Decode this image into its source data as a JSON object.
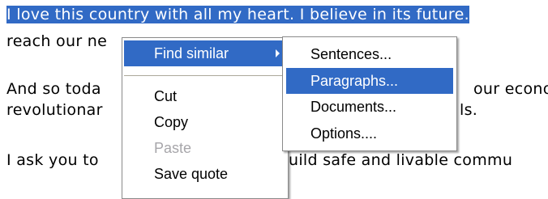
{
  "document": {
    "line1": "I love this country with all my heart. I believe in its future.",
    "line2": "reach our ne",
    "line3_start": "And so toda",
    "line3_end": "our econo",
    "line4_start": "revolutionar",
    "line4_end": "ls.",
    "line5_start": "I ask you to",
    "line5_end": "uild safe and livable commu"
  },
  "context_menu": {
    "find_similar": "Find similar",
    "cut": "Cut",
    "copy": "Copy",
    "paste": "Paste",
    "save_quote": "Save quote"
  },
  "submenu": {
    "sentences": "Sentences...",
    "paragraphs": "Paragraphs...",
    "documents": "Documents...",
    "options": "Options...."
  },
  "colors": {
    "highlight": "#316ac5",
    "disabled_text": "#a7a6aa",
    "menu_border": "#8a8a8a"
  }
}
